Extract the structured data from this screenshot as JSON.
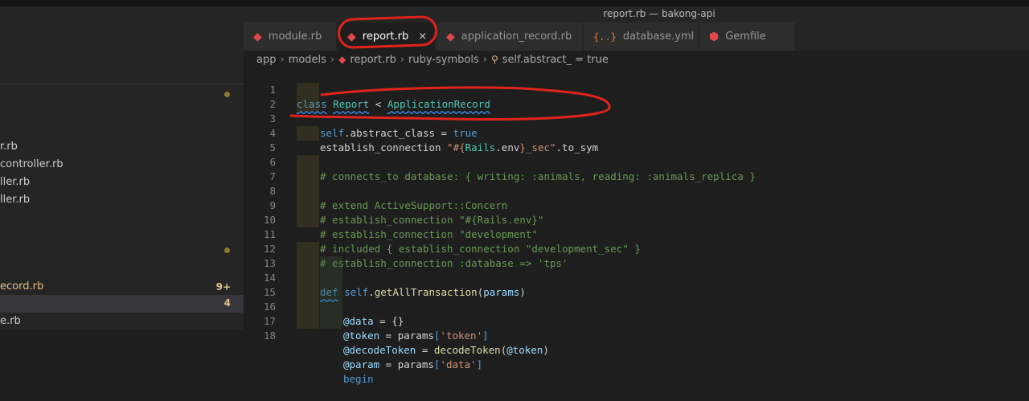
{
  "window": {
    "title": "report.rb — bakong-api"
  },
  "sidebar": {
    "items": [
      {
        "label": "r.rb",
        "modified": false
      },
      {
        "label": "controller.rb",
        "modified": false
      },
      {
        "label": "ller.rb",
        "modified": false
      },
      {
        "label": "ller.rb",
        "modified": false
      },
      {
        "label": "ecord.rb",
        "modified": true,
        "badge": "9+"
      },
      {
        "label": "",
        "modified": true,
        "badge": "4"
      },
      {
        "label": "e.rb",
        "modified": false
      }
    ]
  },
  "tabs": [
    {
      "label": "module.rb",
      "icon": "ruby-gem-icon",
      "active": false
    },
    {
      "label": "report.rb",
      "icon": "ruby-gem-icon",
      "active": true,
      "close": "×"
    },
    {
      "label": "application_record.rb",
      "icon": "ruby-gem-icon",
      "active": false
    },
    {
      "label": "database.yml",
      "icon": "yaml-braces-icon",
      "active": false,
      "icon_text": "{..}"
    },
    {
      "label": "Gemfile",
      "icon": "gemfile-icon",
      "active": false
    }
  ],
  "breadcrumb": {
    "parts": [
      "app",
      "models",
      "report.rb",
      "ruby-symbols",
      "self.abstract_ = true"
    ],
    "separator": "›"
  },
  "code": {
    "lines": [
      {
        "n": "1"
      },
      {
        "n": "2"
      },
      {
        "n": "3"
      },
      {
        "n": "4"
      },
      {
        "n": "5"
      },
      {
        "n": "6"
      },
      {
        "n": "7"
      },
      {
        "n": "8"
      },
      {
        "n": "9"
      },
      {
        "n": "10"
      },
      {
        "n": "11"
      },
      {
        "n": "12"
      },
      {
        "n": "13"
      },
      {
        "n": "14"
      },
      {
        "n": "15"
      },
      {
        "n": "16"
      },
      {
        "n": "17"
      },
      {
        "n": "18"
      }
    ],
    "tokens": {
      "l1_class": "class",
      "l1_name": "Report",
      "l1_lt": " < ",
      "l1_parent": "ApplicationRecord",
      "l2_self": "self",
      "l2_rest": ".abstract_class",
      "l2_eq": " = ",
      "l2_true": "true",
      "l3_fn": "establish_connection ",
      "l3_q1": "\"#{",
      "l3_rails": "Rails",
      "l3_env": ".env",
      "l3_q2": "}_sec\"",
      "l3_sym": ".to_sym",
      "l5": "# connects_to database: { writing: :animals, reading: :animals_replica }",
      "l7": "# extend ActiveSupport::Concern",
      "l8": "# establish_connection \"#{Rails.env}\"",
      "l9": "# establish_connection \"development\"",
      "l10": "# included { establish_connection \"development_sec\" }",
      "l11": "# establish_connection :database => 'tps'",
      "l13_def": "def",
      "l13_self": "self",
      "l13_name": ".getAllTransaction",
      "l13_p1": "(",
      "l13_param": "params",
      "l13_p2": ")",
      "l14_iv": "@data",
      "l14_rest": " = {}",
      "l15_iv": "@token",
      "l15_eq": " = ",
      "l15_params": "params",
      "l15_b1": "[",
      "l15_str": "'token'",
      "l15_b2": "]",
      "l16_iv": "@decodeToken",
      "l16_eq": " = ",
      "l16_fn": "decodeToken",
      "l16_p1": "(",
      "l16_arg": "@token",
      "l16_p2": ")",
      "l17_iv": "@param",
      "l17_eq": " = ",
      "l17_params": "params",
      "l17_b1": "[",
      "l17_str": "'data'",
      "l17_b2": "]",
      "l18": "begin"
    }
  },
  "colors": {
    "annotation": "#e0241c",
    "accent": "#3794ff",
    "modified": "#e2c08d"
  }
}
